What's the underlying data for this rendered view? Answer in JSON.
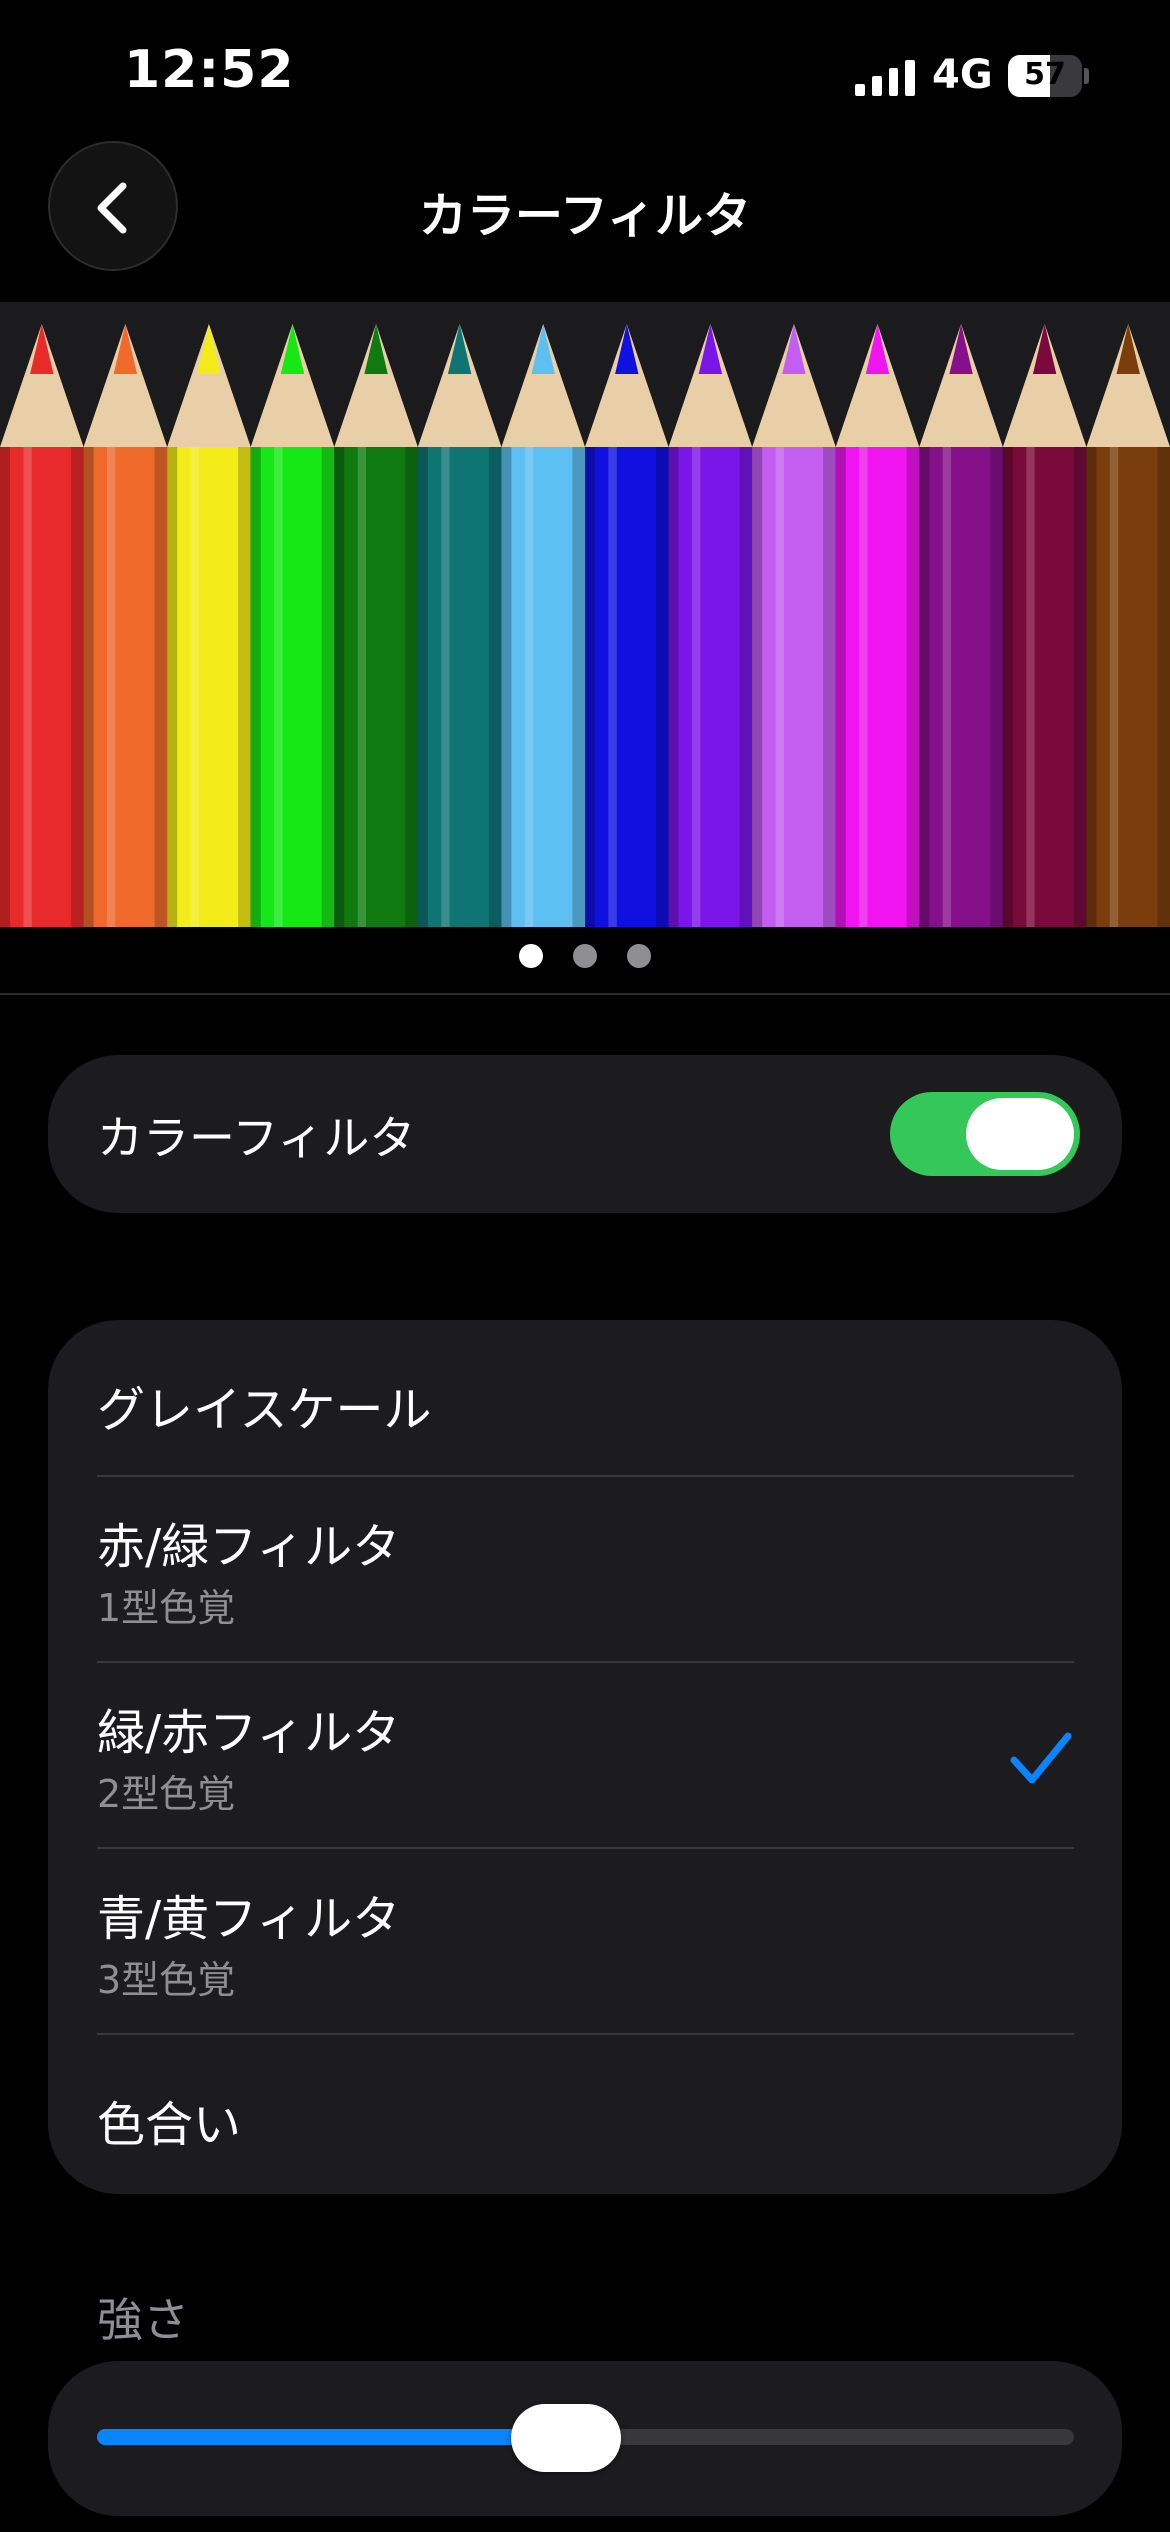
{
  "status_bar": {
    "time": "12:52",
    "network": "4G",
    "battery_level": "57",
    "battery_fraction": 0.57
  },
  "header": {
    "back_icon": "chevron-left-icon",
    "title": "カラーフィルタ"
  },
  "banner": {
    "pencil_colors": [
      "#e82a2a",
      "#f06a2c",
      "#f4ec18",
      "#16e816",
      "#0f7a10",
      "#0e7474",
      "#5cc0f2",
      "#1010e0",
      "#7a16e8",
      "#c35ef0",
      "#f014f0",
      "#86108a",
      "#7a0a3c",
      "#7a3e0c"
    ],
    "page_count": 3,
    "active_page": 0
  },
  "toggle": {
    "label": "カラーフィルタ",
    "on": true,
    "color": "#34c759"
  },
  "filters": [
    {
      "title": "グレイスケール",
      "subtitle": "",
      "selected": false
    },
    {
      "title": "赤/緑フィルタ",
      "subtitle": "1型色覚",
      "selected": false
    },
    {
      "title": "緑/赤フィルタ",
      "subtitle": "2型色覚",
      "selected": true
    },
    {
      "title": "青/黄フィルタ",
      "subtitle": "3型色覚",
      "selected": false
    },
    {
      "title": "色合い",
      "subtitle": "",
      "selected": false
    }
  ],
  "intensity": {
    "label": "強さ",
    "value": 0.48,
    "accent": "#0a84ff"
  }
}
